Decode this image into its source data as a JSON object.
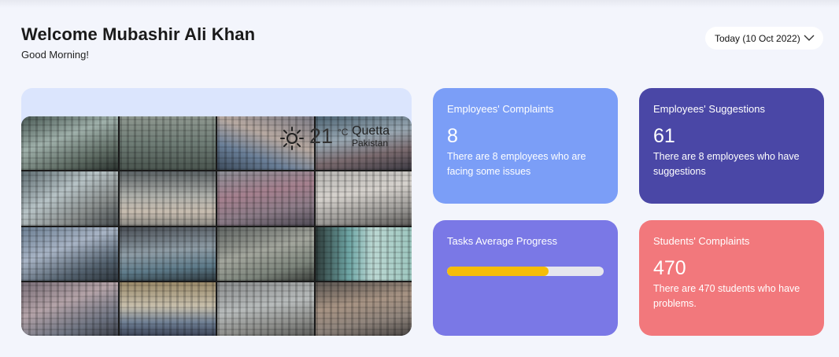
{
  "header": {
    "welcome_title": "Welcome Mubashir Ali Khan",
    "greeting": "Good Morning!"
  },
  "date_selector": {
    "label": "Today (10 Oct 2022)",
    "icon": "chevron-down-icon"
  },
  "weather": {
    "temperature": "21",
    "unit": "°C",
    "city": "Quetta",
    "country": "Pakistan",
    "icon": "sun-icon"
  },
  "cards": {
    "employee_complaints": {
      "title": "Employees' Complaints",
      "value": "8",
      "description": "There are 8 employees who are facing some issues",
      "color": "#7b9ef7"
    },
    "employee_suggestions": {
      "title": "Employees' Suggestions",
      "value": "61",
      "description": "There are 8 employees who have suggestions",
      "color": "#4a47a6"
    },
    "tasks_progress": {
      "title": "Tasks Average Progress",
      "progress_percent": 65,
      "color": "#7a78e6",
      "bar_color": "#f5bd0a"
    },
    "student_complaints": {
      "title": "Students' Complaints",
      "value": "470",
      "description": "There are 470 students who have problems.",
      "color": "#f2787c"
    }
  }
}
